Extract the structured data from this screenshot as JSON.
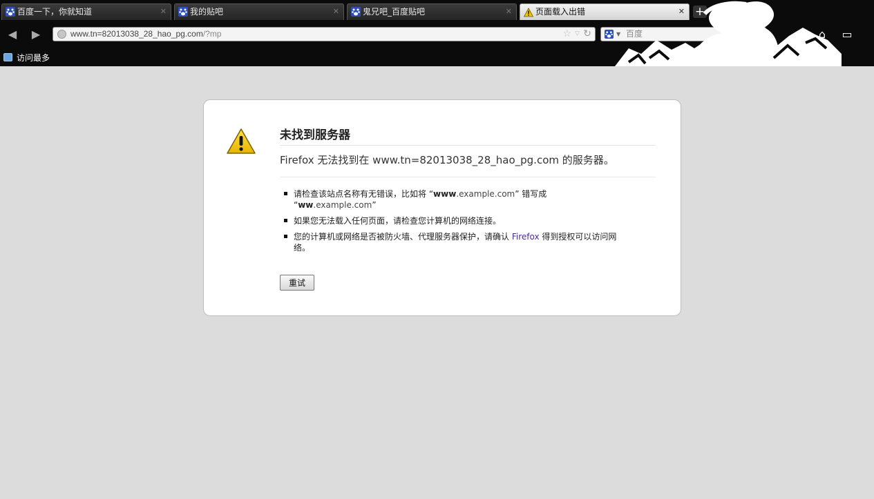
{
  "tabs": [
    {
      "title": "百度一下，你就知道",
      "icon": "baidu-paw-icon",
      "active": false
    },
    {
      "title": "我的贴吧",
      "icon": "baidu-paw-icon",
      "active": false
    },
    {
      "title": "鬼兄吧_百度贴吧",
      "icon": "baidu-paw-icon",
      "active": false
    },
    {
      "title": "页面载入出错",
      "icon": "warning-icon",
      "active": true
    }
  ],
  "tab_close": "✕",
  "new_tab": "+",
  "nav": {
    "back": "◀",
    "forward": "▶",
    "url_host": "www.tn=82013038_28_hao_pg.com",
    "url_path": "/?mp",
    "star": "☆",
    "history_dd": "▽",
    "reload": "↻",
    "search_engine": "百度",
    "search_engine_dd": "▼",
    "search_icon": "magnifier-icon",
    "home": "⌂",
    "window": "▭"
  },
  "bookmarks": [
    {
      "label": "访问最多",
      "icon": "smart-bookmark-icon"
    }
  ],
  "error": {
    "title": "未找到服务器",
    "short_desc": "Firefox 无法找到在 www.tn=82013038_28_hao_pg.com 的服务器。",
    "item1_a": "请检查该站点名称有无错误，比如将 “",
    "item1_b1": "www",
    "item1_c1": ".example.com",
    "item1_d": "” 错写成 “",
    "item1_b2": "ww",
    "item1_c2": ".example.com",
    "item1_e": "”",
    "item2": "如果您无法载入任何页面，请检查您计算机的网络连接。",
    "item3_a": "您的计算机或网络是否被防火墙、代理服务器保护，请确认 ",
    "item3_b": "Firefox",
    "item3_c": " 得到授权可以访问网络。",
    "retry": "重试"
  },
  "colors": {
    "chrome_bg": "#0b0b0b",
    "page_bg": "#dcdcdc",
    "baidu_blue": "#2b4fbd",
    "warning_yellow": "#f5c400"
  }
}
